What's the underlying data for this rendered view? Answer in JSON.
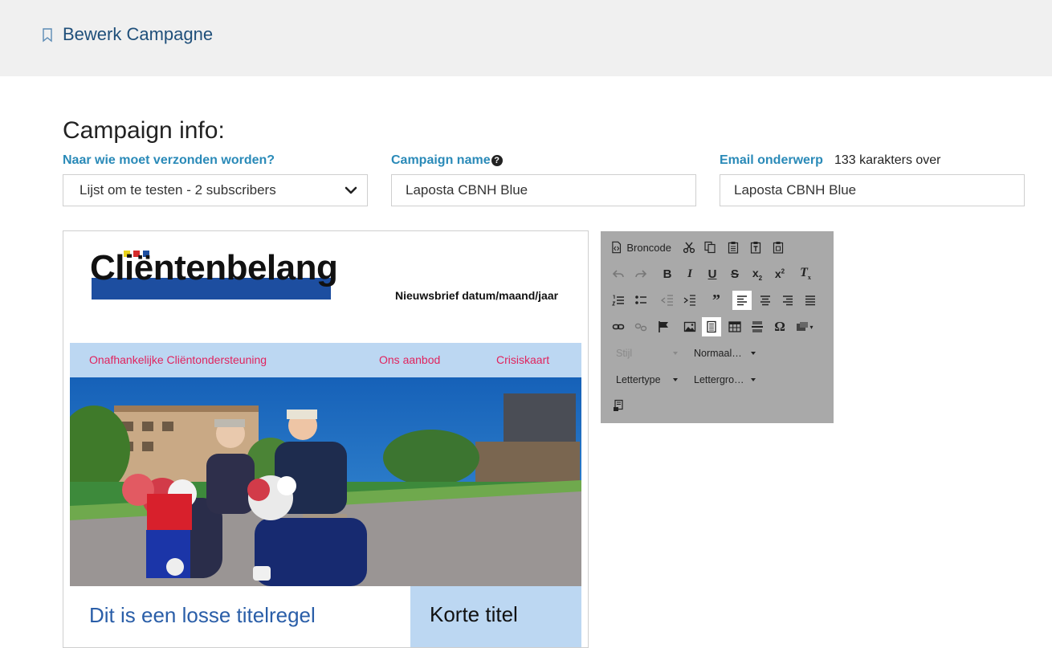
{
  "header": {
    "title": "Bewerk Campagne",
    "bookmark_icon": "bookmark-icon"
  },
  "section_title": "Campaign info:",
  "form": {
    "recipients": {
      "label": "Naar wie moet verzonden worden?",
      "selected": "Lijst om te testen - 2 subscribers"
    },
    "campaign_name": {
      "label": "Campaign name",
      "help_glyph": "?",
      "value": "Laposta CBNH Blue"
    },
    "email_subject": {
      "label": "Email onderwerp",
      "remaining": "133 karakters over",
      "value": "Laposta CBNH Blue"
    }
  },
  "preview": {
    "logo_text": "Cliëntenbelang",
    "logo_colors": [
      "#e8d21b",
      "#d62b2b",
      "#1d4ea0"
    ],
    "date_line": "Nieuwsbrief datum/maand/jaar",
    "nav": [
      "Onafhankelijke Cliëntondersteuning",
      "Ons aanbod",
      "Crisiskaart"
    ],
    "headline": "Dit is een losse titelregel",
    "side_title": "Korte titel"
  },
  "toolbar": {
    "source_label": "Broncode",
    "style_combo": "Stijl",
    "format_combo": "Normaal…",
    "font_combo": "Lettertype",
    "size_combo": "Lettergro…",
    "bg_color": "#a9a9a9"
  }
}
